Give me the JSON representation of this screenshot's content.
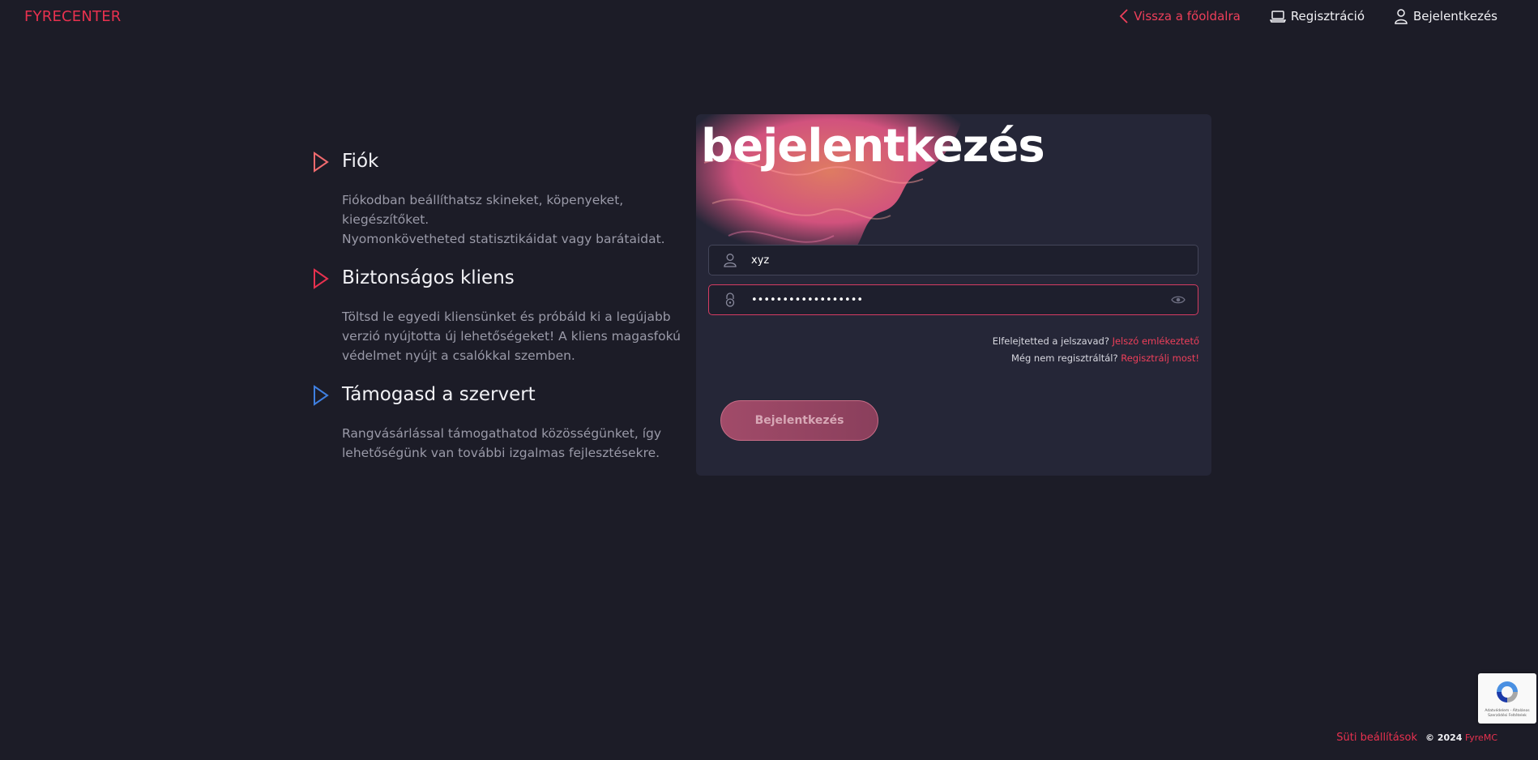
{
  "brand": "FYRECENTER",
  "nav": {
    "back": "Vissza a főoldalra",
    "register": "Regisztráció",
    "login": "Bejelentkezés"
  },
  "features": [
    {
      "title": "Fiók",
      "text": "Fiókodban beállíthatsz skineket, köpenyeket, kiegészítőket.\nNyomonkövetheted statisztikáidat vagy barátaidat.",
      "color": "#f06a6e"
    },
    {
      "title": "Biztonságos kliens",
      "text": "Töltsd le egyedi kliensünket és próbáld ki a legújabb verzió nyújtotta új lehetőségeket! A kliens magasfokú védelmet nyújt a csalókkal szemben.",
      "color": "#e8314f"
    },
    {
      "title": "Támogasd a szervert",
      "text": "Rangvásárlással támogathatod közösségünket, így lehetőségünk van további izgalmas fejlesztésekre.",
      "color": "#3f7fe0"
    }
  ],
  "login_card": {
    "title": "bejelentkezés",
    "username_value": "xyz",
    "password_value": "••••••••••••••••••",
    "forgot_text": "Elfelejtetted a jelszavad?",
    "forgot_link": "Jelszó emlékeztető",
    "register_text": "Még nem regisztráltál?",
    "register_link": "Regisztrálj most!",
    "submit_label": "Bejelentkezés"
  },
  "recaptcha_text": "Adatvédelem - Általános Szerződési Feltételek",
  "footer": {
    "cookie": "Süti beállítások",
    "copyright": "© 2024",
    "brand": "FyreMC"
  },
  "colors": {
    "background": "#1c1c27",
    "card": "#252637",
    "accent": "#e8314f"
  }
}
